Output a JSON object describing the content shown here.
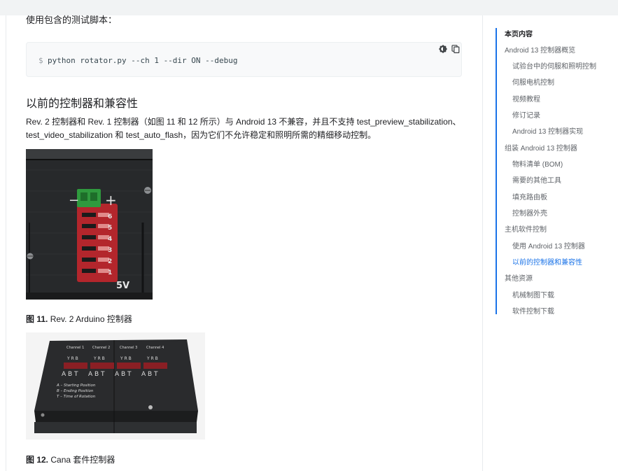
{
  "intro_text": "使用包含的测试脚本：",
  "code": {
    "prompt": "$",
    "command": "python rotator.py --ch 1 --dir ON --debug",
    "icons": [
      "dark-theme-icon",
      "copy-icon"
    ]
  },
  "section": {
    "heading": "以前的控制器和兼容性",
    "paragraph_line1": "Rev. 2 控制器和 Rev. 1 控制器（如图 11 和 12 所示）与 Android 13 不兼容，并且不支持 test_preview_stabilization、",
    "paragraph_line2": "test_video_stabilization 和 test_auto_flash，因为它们不允许稳定和照明所需的精细移动控制。"
  },
  "figure11": {
    "caption_label": "图 11.",
    "caption_text": " Rev. 2 Arduino 控制器",
    "minus": "−",
    "plus": "+",
    "channel_numbers": [
      "6",
      "5",
      "4",
      "3",
      "2",
      "1"
    ],
    "voltage": "5V"
  },
  "figure12": {
    "caption_label": "图 12.",
    "caption_text": " Cana 套件控制器",
    "channels": [
      "Channel 1",
      "Channel 2",
      "Channel 3",
      "Channel 4"
    ],
    "yrb": "Y R B",
    "abt": "A B T",
    "legend": [
      "A – Starting Position",
      "B – Ending Position",
      "T – Time of Rotation"
    ]
  },
  "toc": {
    "title": "本页内容",
    "items": [
      {
        "label": "Android 13 控制器概览",
        "level": 1,
        "active": false
      },
      {
        "label": "试验台中的伺服和照明控制",
        "level": 2,
        "active": false
      },
      {
        "label": "伺服电机控制",
        "level": 2,
        "active": false
      },
      {
        "label": "视频教程",
        "level": 2,
        "active": false
      },
      {
        "label": "修订记录",
        "level": 2,
        "active": false
      },
      {
        "label": "Android 13 控制器实现",
        "level": 2,
        "active": false
      },
      {
        "label": "组装 Android 13 控制器",
        "level": 1,
        "active": false
      },
      {
        "label": "物料清单 (BOM)",
        "level": 2,
        "active": false
      },
      {
        "label": "需要的其他工具",
        "level": 2,
        "active": false
      },
      {
        "label": "填充路由板",
        "level": 2,
        "active": false
      },
      {
        "label": "控制器外壳",
        "level": 2,
        "active": false
      },
      {
        "label": "主机软件控制",
        "level": 1,
        "active": false
      },
      {
        "label": "使用 Android 13 控制器",
        "level": 2,
        "active": false
      },
      {
        "label": "以前的控制器和兼容性",
        "level": 2,
        "active": true
      },
      {
        "label": "其他资源",
        "level": 1,
        "active": false
      },
      {
        "label": "机械制图下载",
        "level": 2,
        "active": false
      },
      {
        "label": "软件控制下载",
        "level": 2,
        "active": false
      }
    ]
  }
}
